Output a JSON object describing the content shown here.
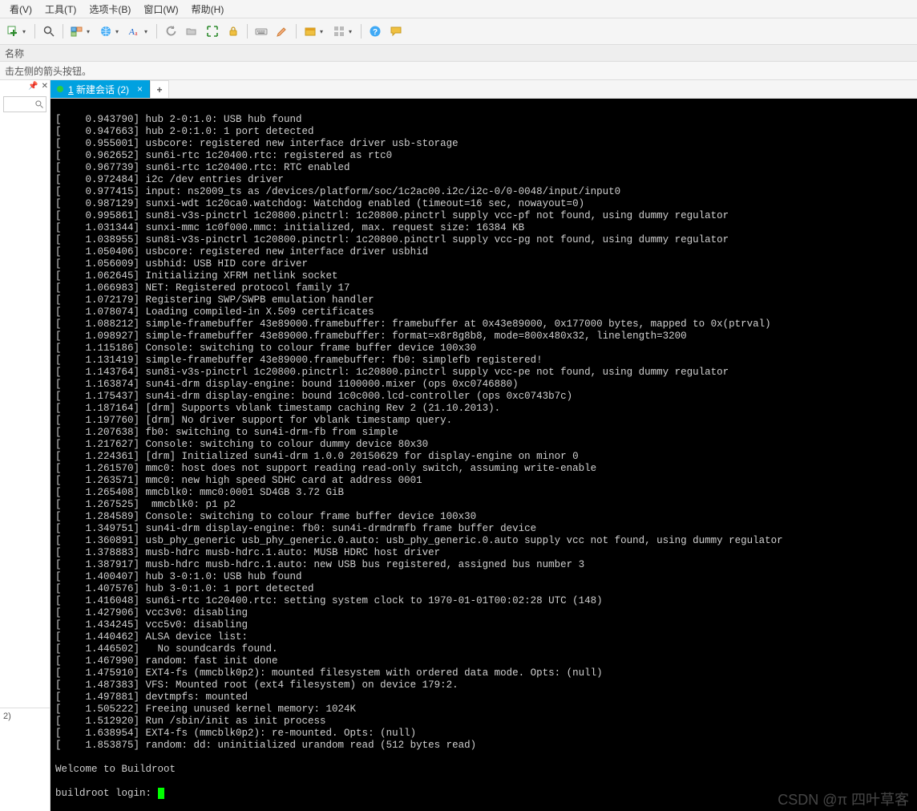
{
  "menu": {
    "items": [
      "看(V)",
      "工具(T)",
      "选项卡(B)",
      "窗口(W)",
      "帮助(H)"
    ]
  },
  "labelbar": {
    "text": "名称"
  },
  "hintbar": {
    "text": "击左侧的箭头按钮。"
  },
  "sidebar": {
    "bottom_text": "2)"
  },
  "tab": {
    "label": "1 新建会话 (2)",
    "add_label": "+"
  },
  "terminal": {
    "lines": [
      "[    0.943790] hub 2-0:1.0: USB hub found",
      "[    0.947663] hub 2-0:1.0: 1 port detected",
      "[    0.955001] usbcore: registered new interface driver usb-storage",
      "[    0.962652] sun6i-rtc 1c20400.rtc: registered as rtc0",
      "[    0.967739] sun6i-rtc 1c20400.rtc: RTC enabled",
      "[    0.972484] i2c /dev entries driver",
      "[    0.977415] input: ns2009_ts as /devices/platform/soc/1c2ac00.i2c/i2c-0/0-0048/input/input0",
      "[    0.987129] sunxi-wdt 1c20ca0.watchdog: Watchdog enabled (timeout=16 sec, nowayout=0)",
      "[    0.995861] sun8i-v3s-pinctrl 1c20800.pinctrl: 1c20800.pinctrl supply vcc-pf not found, using dummy regulator",
      "[    1.031344] sunxi-mmc 1c0f000.mmc: initialized, max. request size: 16384 KB",
      "[    1.038955] sun8i-v3s-pinctrl 1c20800.pinctrl: 1c20800.pinctrl supply vcc-pg not found, using dummy regulator",
      "[    1.050406] usbcore: registered new interface driver usbhid",
      "[    1.056009] usbhid: USB HID core driver",
      "[    1.062645] Initializing XFRM netlink socket",
      "[    1.066983] NET: Registered protocol family 17",
      "[    1.072179] Registering SWP/SWPB emulation handler",
      "[    1.078074] Loading compiled-in X.509 certificates",
      "[    1.088212] simple-framebuffer 43e89000.framebuffer: framebuffer at 0x43e89000, 0x177000 bytes, mapped to 0x(ptrval)",
      "[    1.098927] simple-framebuffer 43e89000.framebuffer: format=x8r8g8b8, mode=800x480x32, linelength=3200",
      "[    1.115186] Console: switching to colour frame buffer device 100x30",
      "[    1.131419] simple-framebuffer 43e89000.framebuffer: fb0: simplefb registered!",
      "[    1.143764] sun8i-v3s-pinctrl 1c20800.pinctrl: 1c20800.pinctrl supply vcc-pe not found, using dummy regulator",
      "[    1.163874] sun4i-drm display-engine: bound 1100000.mixer (ops 0xc0746880)",
      "[    1.175437] sun4i-drm display-engine: bound 1c0c000.lcd-controller (ops 0xc0743b7c)",
      "[    1.187164] [drm] Supports vblank timestamp caching Rev 2 (21.10.2013).",
      "[    1.197760] [drm] No driver support for vblank timestamp query.",
      "[    1.207638] fb0: switching to sun4i-drm-fb from simple",
      "[    1.217627] Console: switching to colour dummy device 80x30",
      "[    1.224361] [drm] Initialized sun4i-drm 1.0.0 20150629 for display-engine on minor 0",
      "[    1.261570] mmc0: host does not support reading read-only switch, assuming write-enable",
      "[    1.263571] mmc0: new high speed SDHC card at address 0001",
      "[    1.265408] mmcblk0: mmc0:0001 SD4GB 3.72 GiB",
      "[    1.267525]  mmcblk0: p1 p2",
      "[    1.284589] Console: switching to colour frame buffer device 100x30",
      "[    1.349751] sun4i-drm display-engine: fb0: sun4i-drmdrmfb frame buffer device",
      "[    1.360891] usb_phy_generic usb_phy_generic.0.auto: usb_phy_generic.0.auto supply vcc not found, using dummy regulator",
      "[    1.378883] musb-hdrc musb-hdrc.1.auto: MUSB HDRC host driver",
      "[    1.387917] musb-hdrc musb-hdrc.1.auto: new USB bus registered, assigned bus number 3",
      "[    1.400407] hub 3-0:1.0: USB hub found",
      "[    1.407576] hub 3-0:1.0: 1 port detected",
      "[    1.416048] sun6i-rtc 1c20400.rtc: setting system clock to 1970-01-01T00:02:28 UTC (148)",
      "[    1.427906] vcc3v0: disabling",
      "[    1.434245] vcc5v0: disabling",
      "[    1.440462] ALSA device list:",
      "[    1.446502]   No soundcards found.",
      "[    1.467990] random: fast init done",
      "[    1.475910] EXT4-fs (mmcblk0p2): mounted filesystem with ordered data mode. Opts: (null)",
      "[    1.487383] VFS: Mounted root (ext4 filesystem) on device 179:2.",
      "[    1.497881] devtmpfs: mounted",
      "[    1.505222] Freeing unused kernel memory: 1024K",
      "[    1.512920] Run /sbin/init as init process",
      "[    1.638954] EXT4-fs (mmcblk0p2): re-mounted. Opts: (null)",
      "[    1.853875] random: dd: uninitialized urandom read (512 bytes read)",
      "",
      "Welcome to Buildroot"
    ],
    "prompt": "buildroot login: "
  },
  "watermark": "CSDN @π 四叶草客"
}
